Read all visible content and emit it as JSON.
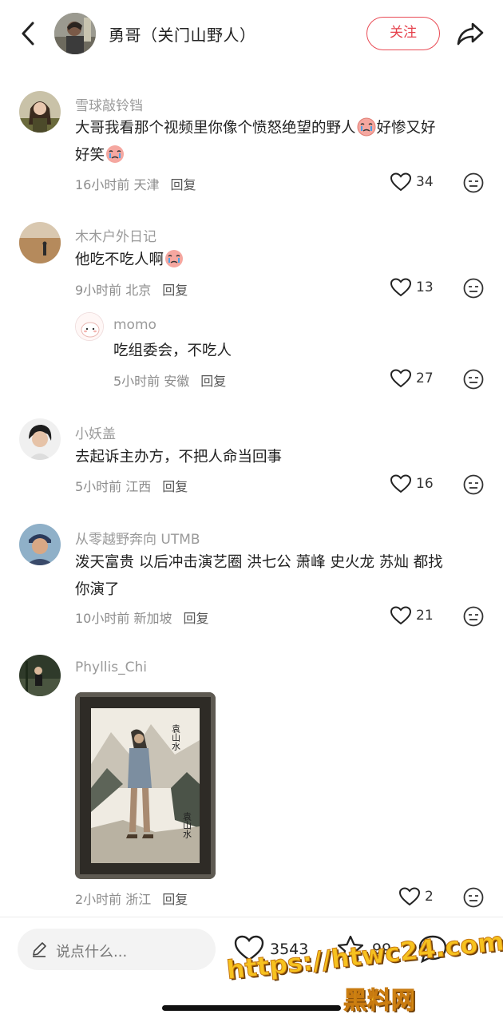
{
  "header": {
    "name": "勇哥（关门山野人）",
    "follow_label": "关注"
  },
  "comments": [
    {
      "username": "雪球敲铃铛",
      "text": "大哥我看那个视频里你像个愤怒绝望的野人",
      "text_after_emoji": "好惨又好",
      "text_line2": "好笑",
      "meta": "16小时前 天津",
      "reply_label": "回复",
      "likes": "34"
    },
    {
      "username": "木木户外日记",
      "text": "他吃不吃人啊",
      "meta": "9小时前 北京",
      "reply_label": "回复",
      "likes": "13"
    },
    {
      "username": "momo",
      "text": "吃组委会，不吃人",
      "meta": "5小时前 安徽",
      "reply_label": "回复",
      "likes": "27"
    },
    {
      "username": "小妖盖",
      "text": "去起诉主办方，不把人命当回事",
      "meta": "5小时前 江西",
      "reply_label": "回复",
      "likes": "16"
    },
    {
      "username": "从零越野奔向 UTMB",
      "text": "泼天富贵 以后冲击演艺圈 洪七公 萧峰 史火龙 苏灿 都找",
      "text_line2": "你演了",
      "meta": "10小时前 新加坡",
      "reply_label": "回复",
      "likes": "21"
    },
    {
      "username": "Phyllis_Chi",
      "meta": "2小时前 浙江",
      "reply_label": "回复",
      "likes": "2",
      "painting_text": "袁山水"
    }
  ],
  "bottom_bar": {
    "input_placeholder": "说点什么...",
    "like_count": "3543",
    "star_count": "99"
  },
  "watermark": {
    "url": "https://htwc24.com",
    "name": "黑料网"
  },
  "colors": {
    "accent": "#e5404b",
    "meta_gray": "#8c8c8c",
    "username_gray": "#9a9a9a"
  }
}
